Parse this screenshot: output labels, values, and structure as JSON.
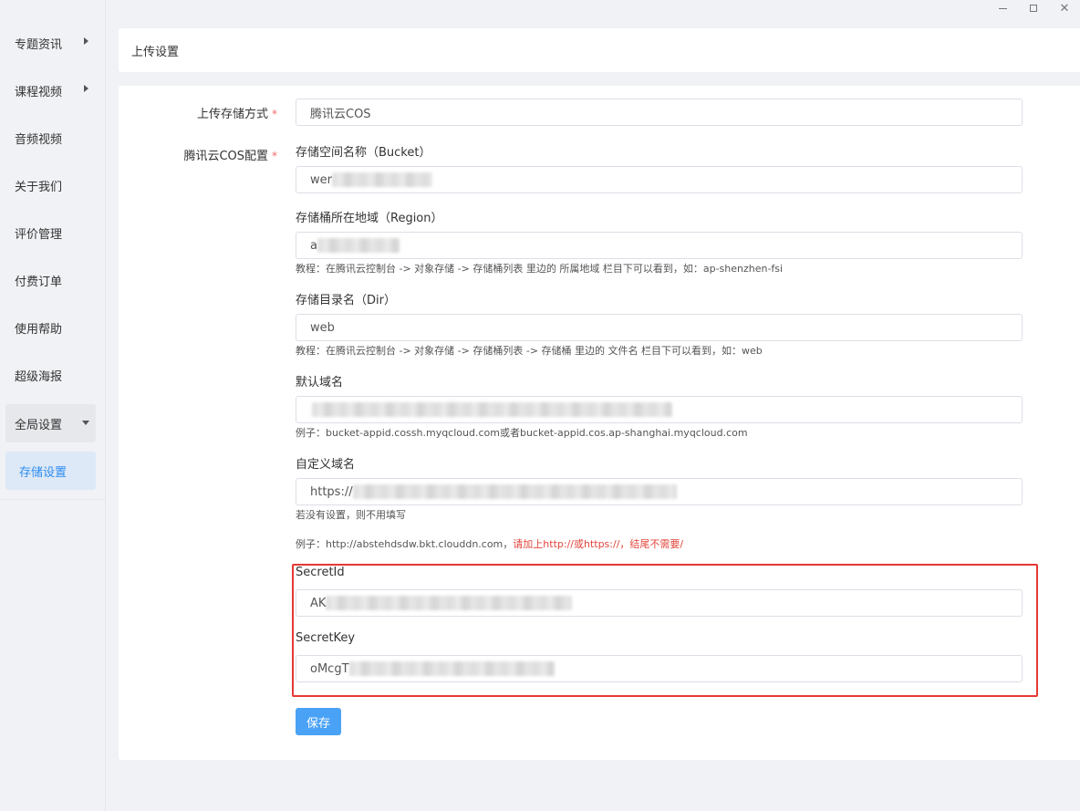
{
  "sidebar": {
    "items": [
      {
        "label": "专题资讯",
        "has_children": true
      },
      {
        "label": "课程视频",
        "has_children": true
      },
      {
        "label": "音频视频",
        "has_children": false
      },
      {
        "label": "关于我们",
        "has_children": false
      },
      {
        "label": "评价管理",
        "has_children": false
      },
      {
        "label": "付费订单",
        "has_children": false
      },
      {
        "label": "使用帮助",
        "has_children": false
      },
      {
        "label": "超级海报",
        "has_children": false
      },
      {
        "label": "全局设置",
        "expanded": true
      },
      {
        "label": "存储设置",
        "active": true
      }
    ]
  },
  "header": {
    "title": "上传设置"
  },
  "form": {
    "storage_method": {
      "label": "上传存储方式",
      "value": "腾讯云COS"
    },
    "cos_config": {
      "label": "腾讯云COS配置"
    },
    "bucket": {
      "title": "存储空间名称（Bucket）",
      "value_visible": "wer"
    },
    "region": {
      "title": "存储桶所在地域（Region）",
      "value_visible": "a",
      "hint": "教程：在腾讯云控制台 -> 对象存储 -> 存储桶列表 里边的 所属地域 栏目下可以看到，如：ap-shenzhen-fsi"
    },
    "dir": {
      "title": "存储目录名（Dir）",
      "value": "web",
      "hint": "教程：在腾讯云控制台 -> 对象存储 -> 存储桶列表 -> 存储桶 里边的 文件名 栏目下可以看到，如：web"
    },
    "default_domain": {
      "title": "默认域名",
      "hint": "例子：bucket-appid.cossh.myqcloud.com或者bucket-appid.cos.ap-shanghai.myqcloud.com"
    },
    "custom_domain": {
      "title": "自定义域名",
      "value_visible": "https://",
      "hint1": "若没有设置，则不用填写",
      "hint2_prefix": "例子：http://abstehdsdw.bkt.clouddn.com，",
      "hint2_warn": "请加上http://或https://，结尾不需要/"
    },
    "secret_id": {
      "title": "SecretId",
      "value_visible": "AK"
    },
    "secret_key": {
      "title": "SecretKey",
      "value_visible": "oMcgT"
    },
    "save_label": "保存"
  },
  "colors": {
    "accent": "#2d8cf0",
    "save_button": "#4aa2f6",
    "required": "#f56c6c",
    "warning_text": "#e2453c",
    "highlight_box": "#e53935"
  }
}
